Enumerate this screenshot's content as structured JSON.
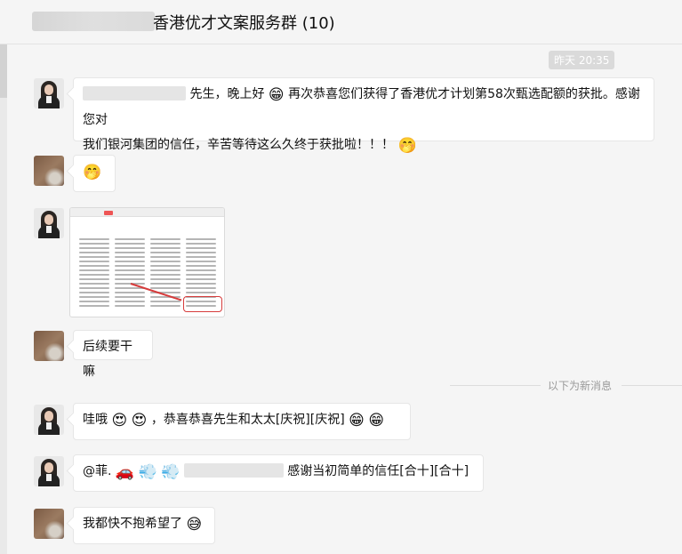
{
  "header": {
    "title": "香港优才文案服务群 (10)"
  },
  "timestamp": "昨天 20:35",
  "new_message_divider": "以下为新消息",
  "messages": [
    {
      "line1_a": "先生，晚上好",
      "emoji1": "😁",
      "line1_b": "再次恭喜您们获得了香港优才计划第58次甄选配额的获批。感谢您对",
      "line2": "我们银河集团的信任，辛苦等待这么久终于获批啦！！！",
      "emoji2": "🤭"
    },
    {
      "emoji": "🤭"
    },
    {
      "image_alt": "screenshot"
    },
    {
      "text": "后续要干嘛"
    },
    {
      "prefix": "哇哦",
      "emoji": "😍",
      "text": "，恭喜恭喜先生和太太[庆祝][庆祝]",
      "emoji2": "😁"
    },
    {
      "prefix": "@菲.",
      "car": "🚗",
      "puff": "💨",
      "text": "感谢当初简单的信任[合十][合十]"
    },
    {
      "text": "我都快不抱希望了",
      "emoji": "😅"
    }
  ]
}
